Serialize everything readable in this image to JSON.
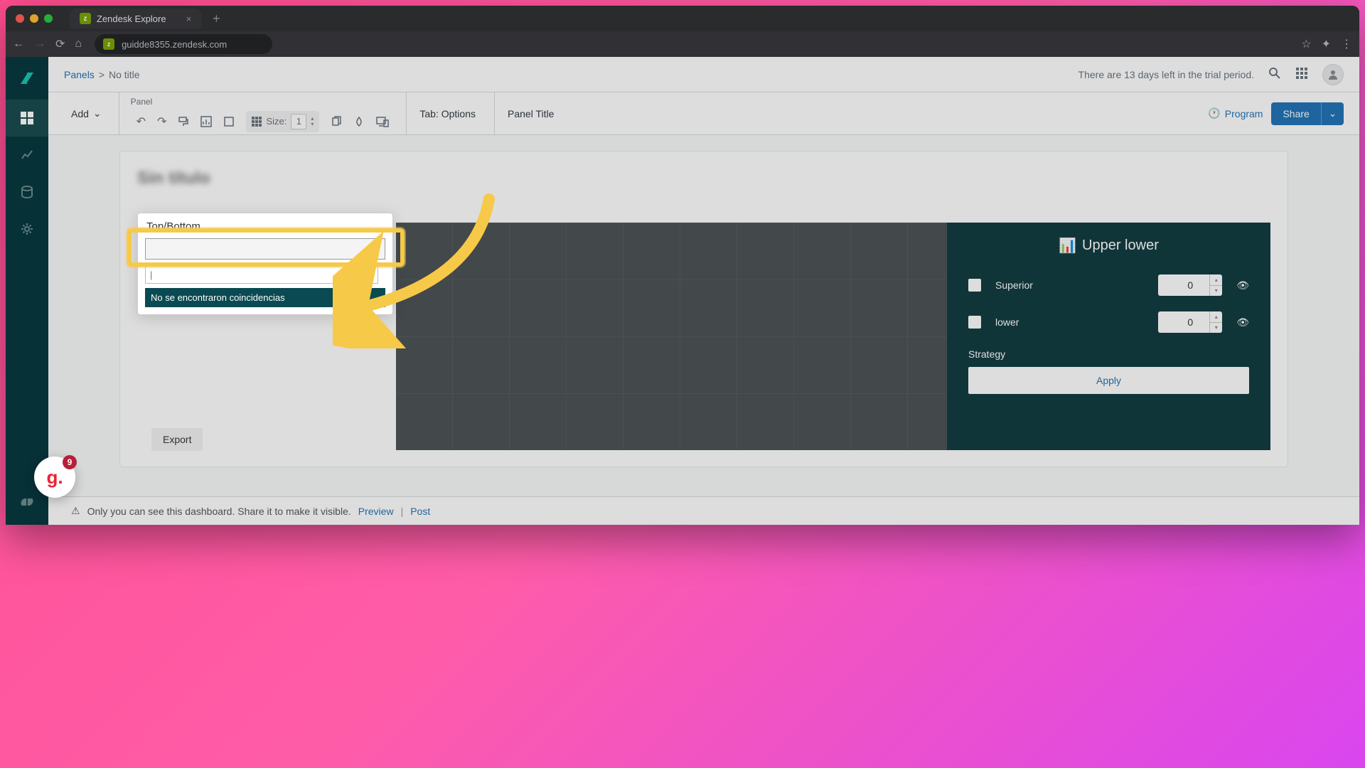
{
  "browser": {
    "tab_title": "Zendesk Explore",
    "url": "guidde8355.zendesk.com"
  },
  "topbar": {
    "breadcrumb_panels": "Panels",
    "breadcrumb_sep": ">",
    "breadcrumb_current": "No title",
    "trial_notice": "There are 13 days left in the trial period."
  },
  "toolbar": {
    "add_label": "Add",
    "panel_heading": "Panel",
    "size_label": "Size:",
    "size_value": "1",
    "tab_options": "Tab: Options",
    "panel_title": "Panel Title",
    "program_label": "Program",
    "share_label": "Share"
  },
  "widget": {
    "blur_title": "Sin título",
    "dropdown_label": "Top/Bottom",
    "no_match": "No se encontraron coincidencias",
    "export_label": "Export"
  },
  "dark_panel": {
    "title": "Upper lower",
    "row_superior": "Superior",
    "row_lower": "lower",
    "value_superior": "0",
    "value_lower": "0",
    "strategy_label": "Strategy",
    "apply_label": "Apply"
  },
  "bottombar": {
    "warning": "Only you can see this dashboard. Share it to make it visible.",
    "preview": "Preview",
    "post": "Post"
  },
  "badge": {
    "letter": "g.",
    "count": "9"
  },
  "search_placeholder": "|"
}
